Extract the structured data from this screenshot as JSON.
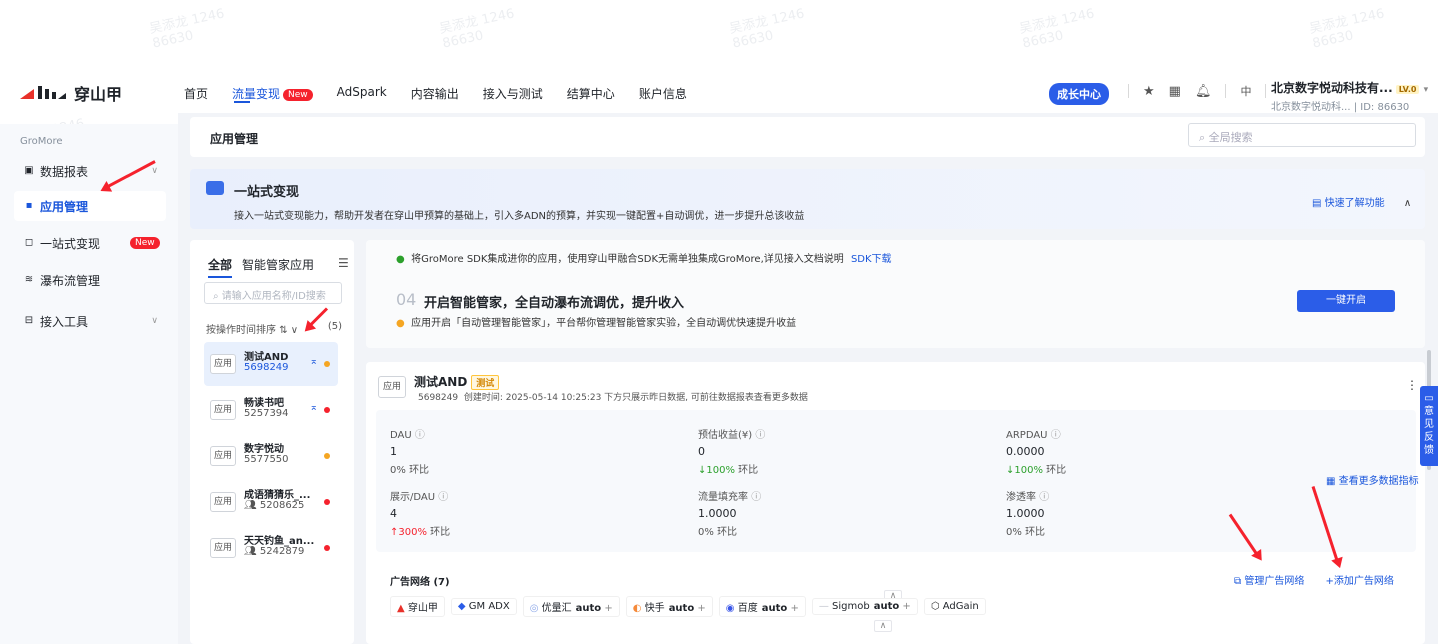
{
  "watermark": {
    "name": "吴添龙 1246",
    "id": "86630"
  },
  "nav": {
    "logo_text": "穿山甲",
    "items": [
      "首页",
      "流量变现",
      "AdSpark",
      "内容输出",
      "接入与测试",
      "结算中心",
      "账户信息"
    ],
    "new_badge": "New",
    "growth": "成长中心",
    "lang": "中",
    "company_name": "北京数字悦动科技有...",
    "level": "LV.0",
    "company_sub": "北京数字悦动科...",
    "company_id": "| ID: 86630"
  },
  "sidebar": {
    "title": "GroMore",
    "items": [
      {
        "label": "数据报表"
      },
      {
        "label": "应用管理"
      },
      {
        "label": "一站式变现",
        "badge": "New"
      },
      {
        "label": "瀑布流管理"
      },
      {
        "label": "接入工具"
      }
    ]
  },
  "header": {
    "title": "应用管理",
    "search_placeholder": "全局搜索"
  },
  "banner": {
    "title": "一站式变现",
    "desc": "接入一站式变现能力，帮助开发者在穿山甲预算的基础上，引入多ADN的预算，并实现一键配置+自动调优，进一步提升总该收益",
    "quick_link": "快速了解功能"
  },
  "app_panel": {
    "tabs": [
      "全部",
      "智能管家应用"
    ],
    "search_placeholder": "请输入应用名称/ID搜索",
    "sort_label": "按操作时间排序",
    "count": "(5)",
    "tag": "应用",
    "apps": [
      {
        "name": "测试AND",
        "id": "5698249",
        "dot": "#f5a623"
      },
      {
        "name": "畅读书吧",
        "id": "5257394",
        "dot": "#f5222d"
      },
      {
        "name": "数字悦动",
        "id": "5577550",
        "dot": "#f5a623"
      },
      {
        "name": "成语猜猜乐_...",
        "id": "5208625",
        "dot": "#f5222d"
      },
      {
        "name": "天天钓鱼_an...",
        "id": "5242879",
        "dot": "#f5222d"
      }
    ]
  },
  "steps": {
    "step1_text": "将GroMore SDK集成进你的应用，使用穿山甲融合SDK无需单独集成GroMore,详见接入文档说明",
    "step1_link": "SDK下载",
    "step4_num": "04",
    "step4_title": "开启智能管家，全自动瀑布流调优，提升收入",
    "step4_text": "应用开启「自动管理智能管家」，平台帮你管理智能管家实验，全自动调优快速提升收益",
    "enable_button": "一键开启"
  },
  "detail": {
    "tag": "应用",
    "name": "测试AND",
    "test_tag": "测试",
    "app_id": "5698249",
    "meta": "创建时间: 2025-05-14 10:25:23   下方只展示昨日数据, 可前往数据报表查看更多数据",
    "more_metrics": "查看更多数据指标",
    "metrics": [
      {
        "label": "DAU",
        "value": "1",
        "change": "0%",
        "suffix": "环比",
        "dir": "none"
      },
      {
        "label": "预估收益(¥)",
        "value": "0",
        "change": "↓100%",
        "suffix": "环比",
        "dir": "down"
      },
      {
        "label": "ARPDAU",
        "value": "0.0000",
        "change": "↓100%",
        "suffix": "环比",
        "dir": "down"
      },
      {
        "label": "展示/DAU",
        "value": "4",
        "change": "↑300%",
        "suffix": "环比",
        "dir": "up"
      },
      {
        "label": "流量填充率",
        "value": "1.0000",
        "change": "0%",
        "suffix": "环比",
        "dir": "none"
      },
      {
        "label": "渗透率",
        "value": "1.0000",
        "change": "0%",
        "suffix": "环比",
        "dir": "none"
      }
    ],
    "network_title": "广告网络 (7)",
    "manage_network": "管理广告网络",
    "add_network": "+添加广告网络",
    "networks": [
      {
        "name": "穿山甲",
        "auto": ""
      },
      {
        "name": "GM ADX",
        "auto": ""
      },
      {
        "name": "优量汇",
        "auto": "auto"
      },
      {
        "name": "快手",
        "auto": "auto"
      },
      {
        "name": "百度",
        "auto": "auto"
      },
      {
        "name": "Sigmob",
        "auto": "auto"
      },
      {
        "name": "AdGain",
        "auto": ""
      }
    ]
  },
  "feedback": "意见反馈"
}
